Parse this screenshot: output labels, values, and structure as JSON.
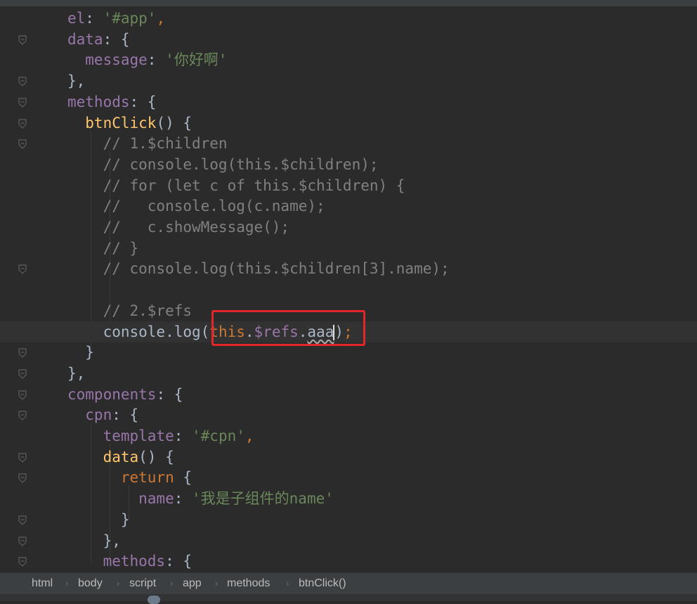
{
  "code": {
    "lines": [
      [
        {
          "t": "el",
          "c": "prop"
        },
        {
          "t": ": ",
          "c": "plain"
        },
        {
          "t": "'#app'",
          "c": "str"
        },
        {
          "t": ",",
          "c": "kw"
        }
      ],
      [
        {
          "t": "data",
          "c": "prop"
        },
        {
          "t": ": {",
          "c": "plain"
        }
      ],
      [
        {
          "t": "  message",
          "c": "prop"
        },
        {
          "t": ": ",
          "c": "plain"
        },
        {
          "t": "'你好啊'",
          "c": "str"
        }
      ],
      [
        {
          "t": "},",
          "c": "plain"
        }
      ],
      [
        {
          "t": "methods",
          "c": "prop"
        },
        {
          "t": ": {",
          "c": "plain"
        }
      ],
      [
        {
          "t": "  btnClick",
          "c": "fn"
        },
        {
          "t": "() {",
          "c": "plain"
        }
      ],
      [
        {
          "t": "    // 1.$children",
          "c": "com"
        }
      ],
      [
        {
          "t": "    // console.log(this.$children);",
          "c": "com"
        }
      ],
      [
        {
          "t": "    // for (let c of this.$children) {",
          "c": "com"
        }
      ],
      [
        {
          "t": "    //   console.log(c.name);",
          "c": "com"
        }
      ],
      [
        {
          "t": "    //   c.showMessage();",
          "c": "com"
        }
      ],
      [
        {
          "t": "    // }",
          "c": "com"
        }
      ],
      [
        {
          "t": "    // console.log(this.$children[3].name);",
          "c": "com"
        }
      ],
      [],
      [
        {
          "t": "    // 2.$refs",
          "c": "com"
        }
      ],
      [
        {
          "t": "    console.log(",
          "c": "plain"
        },
        {
          "t": "this",
          "c": "kw"
        },
        {
          "t": ".",
          "c": "plain"
        },
        {
          "t": "$refs",
          "c": "prop"
        },
        {
          "t": ".",
          "c": "plain"
        },
        {
          "t": "aaa",
          "c": "plain squiggle"
        },
        {
          "t": "|CARET|",
          "c": "caret"
        },
        {
          "t": ")",
          "c": "plain"
        },
        {
          "t": ";",
          "c": "kw"
        }
      ],
      [
        {
          "t": "  }",
          "c": "plain"
        }
      ],
      [
        {
          "t": "},",
          "c": "plain"
        }
      ],
      [
        {
          "t": "components",
          "c": "prop"
        },
        {
          "t": ": {",
          "c": "plain"
        }
      ],
      [
        {
          "t": "  cpn",
          "c": "prop"
        },
        {
          "t": ": {",
          "c": "plain"
        }
      ],
      [
        {
          "t": "    template",
          "c": "prop"
        },
        {
          "t": ": ",
          "c": "plain"
        },
        {
          "t": "'#cpn'",
          "c": "str"
        },
        {
          "t": ",",
          "c": "kw"
        }
      ],
      [
        {
          "t": "    data",
          "c": "fn"
        },
        {
          "t": "() {",
          "c": "plain"
        }
      ],
      [
        {
          "t": "      return",
          "c": "kw"
        },
        {
          "t": " {",
          "c": "plain"
        }
      ],
      [
        {
          "t": "        name",
          "c": "prop"
        },
        {
          "t": ": ",
          "c": "plain"
        },
        {
          "t": "'我是子组件的name'",
          "c": "str"
        }
      ],
      [
        {
          "t": "      }",
          "c": "plain"
        }
      ],
      [
        {
          "t": "    },",
          "c": "plain"
        }
      ],
      [
        {
          "t": "    methods",
          "c": "prop"
        },
        {
          "t": ": {",
          "c": "plain"
        }
      ]
    ]
  },
  "statusbar": {
    "breadcrumbs": [
      "html",
      "body",
      "script",
      "app",
      "methods",
      "btnClick()"
    ]
  },
  "colors": {
    "background": "#2b2b2b",
    "highlight_box": "#e2262b"
  }
}
